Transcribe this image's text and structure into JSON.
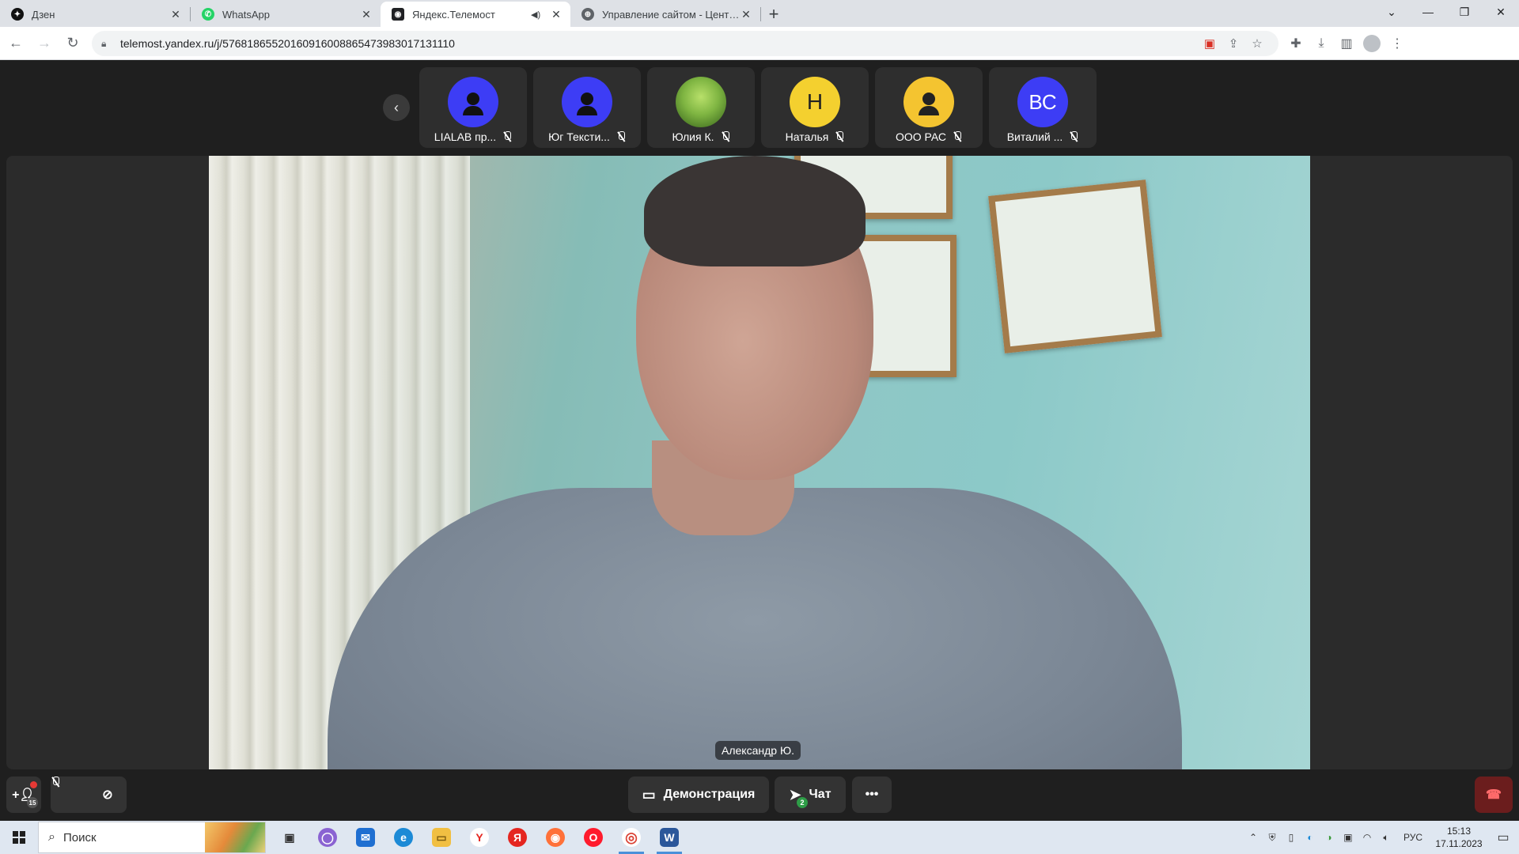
{
  "browser": {
    "tabs": [
      {
        "title": "Дзен",
        "favicon_color": "#111111",
        "favicon_glyph": "✦"
      },
      {
        "title": "WhatsApp",
        "favicon_color": "#25d366",
        "favicon_glyph": "✆"
      },
      {
        "title": "Яндекс.Телемост",
        "favicon_color": "#202124",
        "favicon_glyph": "◉",
        "active": true,
        "playing_audio": true
      },
      {
        "title": "Управление сайтом - Центр по",
        "favicon_color": "#5f6368",
        "favicon_glyph": "⊕"
      }
    ],
    "address": "telemost.yandex.ru/j/57681865520160916008865473983017131110"
  },
  "telemost": {
    "participants": [
      {
        "name": "LIALAB пр...",
        "avatar_type": "icon",
        "avatar_color": "#3d3df5",
        "muted": true
      },
      {
        "name": "Юг Тексти...",
        "avatar_type": "icon",
        "avatar_color": "#3d3df5",
        "muted": true
      },
      {
        "name": "Юлия К.",
        "avatar_type": "photo",
        "avatar_color": "#7fb542",
        "muted": true
      },
      {
        "name": "Наталья",
        "avatar_type": "initial",
        "initial": "Н",
        "avatar_color": "#f4d02f",
        "muted": true
      },
      {
        "name": "ООО РАС",
        "avatar_type": "icon",
        "avatar_color": "#f4c430",
        "muted": true
      },
      {
        "name": "Виталий ...",
        "avatar_type": "initial",
        "initial": "ВС",
        "avatar_color": "#3d3df5",
        "muted": true
      }
    ],
    "speaker_name": "Александр Ю.",
    "controls": {
      "participants_count": "15",
      "demo_label": "Демонстрация",
      "chat_label": "Чат",
      "chat_unread": "2",
      "more_label": "•••"
    }
  },
  "taskbar": {
    "search_placeholder": "Поиск",
    "language": "РУС",
    "time": "15:13",
    "date": "17.11.2023",
    "apps": [
      {
        "name": "task-view",
        "color": "#3a3a3a",
        "glyph": "▣"
      },
      {
        "name": "cortana",
        "color": "#8a63d2",
        "glyph": "◯"
      },
      {
        "name": "mail",
        "color": "#1f6fd1",
        "glyph": "✉"
      },
      {
        "name": "edge",
        "color": "#1c8ad6",
        "glyph": "e"
      },
      {
        "name": "explorer",
        "color": "#f1bf42",
        "glyph": "▭"
      },
      {
        "name": "yandex-browser",
        "color": "#ffffff",
        "glyph": "Y",
        "glyph_color": "#e52620"
      },
      {
        "name": "yandex",
        "color": "#e52620",
        "glyph": "Я"
      },
      {
        "name": "firefox",
        "color": "#ff7139",
        "glyph": "◉"
      },
      {
        "name": "opera",
        "color": "#ff1b2d",
        "glyph": "O"
      },
      {
        "name": "chrome",
        "color": "#ffffff",
        "glyph": "◎",
        "glyph_color": "#db4437",
        "active": true
      },
      {
        "name": "word",
        "color": "#2b579a",
        "glyph": "W",
        "active": true
      }
    ]
  }
}
